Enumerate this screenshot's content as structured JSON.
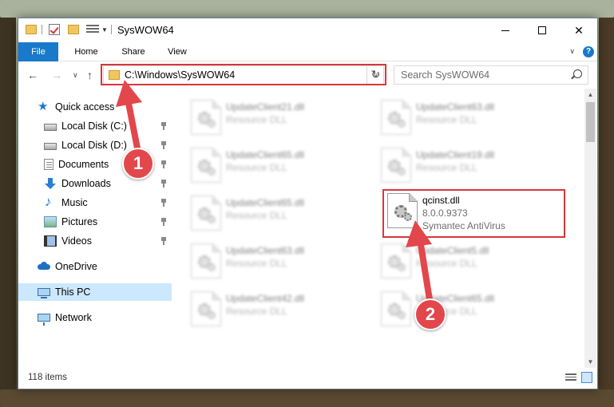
{
  "window": {
    "title": "SysWOW64"
  },
  "ribbon": {
    "tabs": [
      "File",
      "Home",
      "Share",
      "View"
    ]
  },
  "nav": {
    "address": "C:\\Windows\\SysWOW64",
    "search_placeholder": "Search SysWOW64"
  },
  "sidebar": {
    "items": [
      {
        "label": "Quick access",
        "icon": "star-icon",
        "pinned": false
      },
      {
        "label": "Local Disk (C:)",
        "icon": "drive-icon",
        "pinned": true
      },
      {
        "label": "Local Disk (D:)",
        "icon": "drive-icon",
        "pinned": true
      },
      {
        "label": "Documents",
        "icon": "documents-icon",
        "pinned": true
      },
      {
        "label": "Downloads",
        "icon": "download-icon",
        "pinned": true
      },
      {
        "label": "Music",
        "icon": "music-icon",
        "pinned": true
      },
      {
        "label": "Pictures",
        "icon": "pictures-icon",
        "pinned": true
      },
      {
        "label": "Videos",
        "icon": "videos-icon",
        "pinned": true
      },
      {
        "label": "OneDrive",
        "icon": "onedrive-icon",
        "pinned": false
      },
      {
        "label": "This PC",
        "icon": "pc-icon",
        "selected": true
      },
      {
        "label": "Network",
        "icon": "network-icon",
        "pinned": false
      }
    ]
  },
  "files": [
    {
      "name": "UpdateClient21.dll",
      "type": "Resource DLL",
      "blurred": true
    },
    {
      "name": "UpdateClient63.dll",
      "type": "Resource DLL",
      "blurred": true
    },
    {
      "name": "UpdateClient65.dll",
      "type": "Resource DLL",
      "blurred": true
    },
    {
      "name": "UpdateClient19.dll",
      "type": "Resource DLL",
      "blurred": true
    },
    {
      "name": "UpdateClient65.dll",
      "type": "Resource DLL",
      "blurred": true
    },
    {
      "name": "qcinst.dll",
      "version": "8.0.0.9373",
      "company": "Symantec AntiVirus",
      "blurred": false,
      "highlighted": true
    },
    {
      "name": "UpdateClient63.dll",
      "type": "Resource DLL",
      "blurred": true
    },
    {
      "name": "UpdateClient5.dll",
      "type": "Resource DLL",
      "blurred": true
    },
    {
      "name": "UpdateClient42.dll",
      "type": "Resource DLL",
      "blurred": true
    },
    {
      "name": "UpdateClient65.dll",
      "type": "Resource DLL",
      "blurred": true
    }
  ],
  "status": {
    "item_count": "118 items"
  },
  "annotations": {
    "step1": "1",
    "step2": "2",
    "color": "#e2474c"
  }
}
